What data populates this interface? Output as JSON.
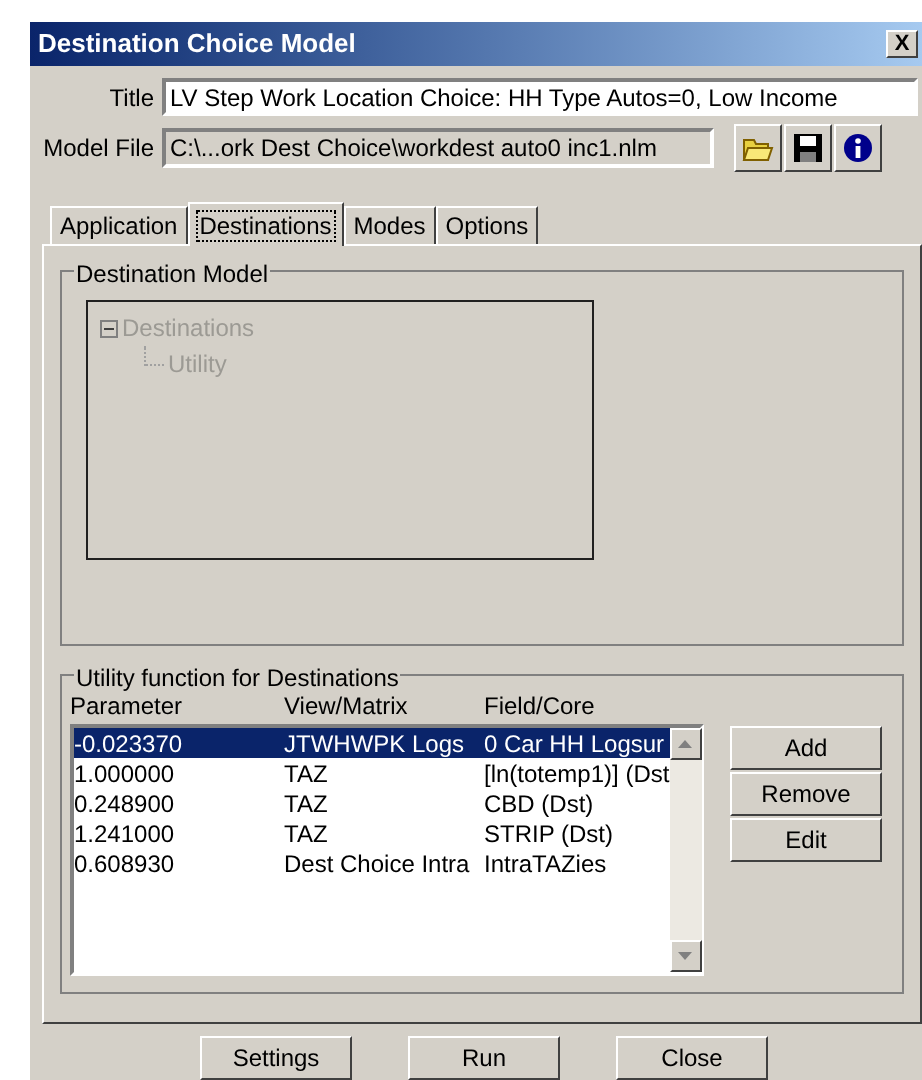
{
  "window": {
    "title": "Destination Choice Model",
    "close": "X"
  },
  "title_field": {
    "label": "Title",
    "value": "LV Step Work Location Choice: HH Type Autos=0, Low Income"
  },
  "model_file": {
    "label": "Model File",
    "value": "C:\\...ork Dest Choice\\workdest auto0 inc1.nlm"
  },
  "tabs": [
    {
      "label": "Application",
      "selected": false
    },
    {
      "label": "Destinations",
      "selected": true
    },
    {
      "label": "Modes",
      "selected": false
    },
    {
      "label": "Options",
      "selected": false
    }
  ],
  "destination_model": {
    "title": "Destination Model",
    "disabled": true,
    "tree": [
      {
        "label": "Destinations",
        "expanded": true,
        "children": [
          {
            "label": "Utility"
          }
        ]
      }
    ]
  },
  "utility": {
    "title": "Utility function for Destinations",
    "columns": [
      "Parameter",
      "View/Matrix",
      "Field/Core"
    ],
    "rows": [
      {
        "cells": [
          "-0.023370",
          "JTWHWPK Logs",
          "0 Car HH Logsur"
        ],
        "selected": true
      },
      {
        "cells": [
          "1.000000",
          "TAZ",
          "[ln(totemp1)] (Dst"
        ],
        "selected": false
      },
      {
        "cells": [
          "0.248900",
          "TAZ",
          "CBD (Dst)"
        ],
        "selected": false
      },
      {
        "cells": [
          "1.241000",
          "TAZ",
          "STRIP (Dst)"
        ],
        "selected": false
      },
      {
        "cells": [
          "0.608930",
          "Dest Choice Intra",
          "IntraTAZies"
        ],
        "selected": false
      }
    ],
    "buttons": [
      "Add",
      "Remove",
      "Edit"
    ]
  },
  "buttons": [
    "Settings",
    "Run",
    "Close"
  ]
}
